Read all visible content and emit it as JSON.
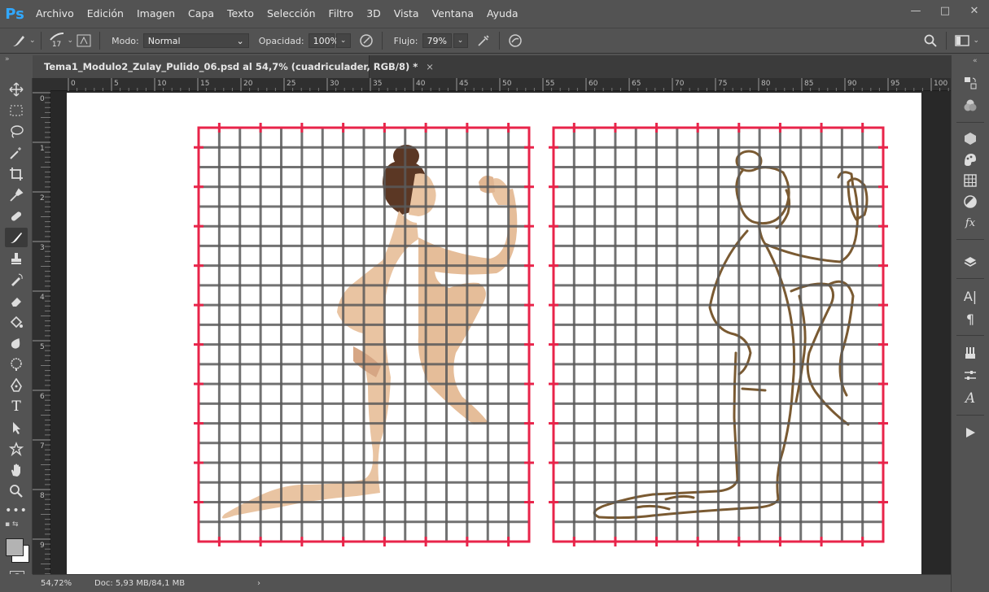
{
  "app": {
    "logo": "Ps"
  },
  "menu": [
    "Archivo",
    "Edición",
    "Imagen",
    "Capa",
    "Texto",
    "Selección",
    "Filtro",
    "3D",
    "Vista",
    "Ventana",
    "Ayuda"
  ],
  "window_controls": {
    "minimize": "—",
    "maximize": "□",
    "close": "✕"
  },
  "options": {
    "brush_size": "17",
    "mode_label": "Modo:",
    "mode_value": "Normal",
    "opacity_label": "Opacidad:",
    "opacity_value": "100%",
    "flow_label": "Flujo:",
    "flow_value": "79%"
  },
  "document": {
    "tab_title": "Tema1_Modulo2_Zulay_Pulido_06.psd al 54,7% (cuadriculader, RGB/8) *",
    "close_icon": "×"
  },
  "rulers": {
    "top": [
      "0",
      "5",
      "10",
      "15",
      "20",
      "25",
      "30",
      "35",
      "40",
      "45",
      "50",
      "55",
      "60",
      "65",
      "70",
      "75",
      "80",
      "85",
      "90",
      "95",
      "100"
    ],
    "left": [
      "0",
      "1",
      "2",
      "3",
      "4",
      "5",
      "6",
      "7",
      "8",
      "9"
    ]
  },
  "status": {
    "zoom": "54,72%",
    "doc_info": "Doc: 5,93 MB/84,1 MB",
    "arrow": "›"
  },
  "colors": {
    "grid_line": "#5a5a5a",
    "grid_border": "#e8244a",
    "sketch": "#7a5a32",
    "skin": "#e9c4a2",
    "hair": "#5b3724"
  },
  "tools": [
    "move-tool",
    "marquee-tool",
    "lasso-tool",
    "magic-wand-tool",
    "crop-tool",
    "eyedropper-tool",
    "healing-brush-tool",
    "brush-tool",
    "clone-stamp-tool",
    "history-brush-tool",
    "eraser-tool",
    "paint-bucket-tool",
    "blur-tool",
    "dodge-tool",
    "pen-tool",
    "type-tool",
    "path-selection-tool",
    "shape-tool",
    "hand-tool",
    "zoom-tool",
    "more-tools"
  ],
  "right_panels": [
    "history-panel",
    "color-panel",
    "3d-panel",
    "swatches-panel",
    "grid-panel",
    "adjustments-panel",
    "styles-panel",
    "layers-panel",
    "character-panel",
    "paragraph-panel",
    "brushes-panel",
    "properties-panel",
    "glyphs-panel",
    "actions-panel"
  ]
}
